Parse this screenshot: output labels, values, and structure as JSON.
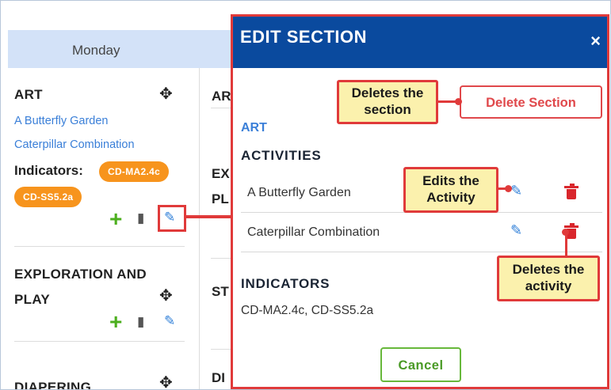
{
  "calendar": {
    "day": "Monday",
    "sections": [
      {
        "title": "ART",
        "activities": [
          "A Butterfly Garden",
          "Caterpillar Combination"
        ],
        "indicators_label": "Indicators:",
        "indicators": [
          "CD-MA2.4c",
          "CD-SS5.2a"
        ]
      },
      {
        "title_line1": "EXPLORATION AND",
        "title_line2": "PLAY"
      },
      {
        "title": "DIAPERING"
      }
    ],
    "next_col": [
      "AR",
      "EX",
      "PL",
      "ST",
      "DI"
    ]
  },
  "modal": {
    "title": "EDIT SECTION",
    "close": "×",
    "delete_section": "Delete Section",
    "section_name": "ART",
    "activities_heading": "ACTIVITIES",
    "activities": [
      "A Butterfly Garden",
      "Caterpillar Combination"
    ],
    "indicators_heading": "INDICATORS",
    "indicators_text": "CD-MA2.4c, CD-SS5.2a",
    "cancel": "Cancel"
  },
  "callouts": {
    "delete_section": [
      "Deletes the",
      "section"
    ],
    "edit_activity": [
      "Edits the",
      "Activity"
    ],
    "delete_activity": [
      "Deletes the",
      "activity"
    ]
  },
  "icons": {
    "move": "move-arrows-icon",
    "add": "plus-icon",
    "copy": "copy-icon",
    "edit": "edit-icon",
    "trash": "trash-icon",
    "close": "close-icon"
  },
  "colors": {
    "header_blue": "#0a4a9e",
    "day_header": "#d3e2f8",
    "indicator_pill": "#f7941d",
    "highlight_red": "#e03a3a",
    "callout_yellow": "#fbf1ad",
    "link_blue": "#3a7fd8",
    "add_green": "#4caf1e"
  }
}
